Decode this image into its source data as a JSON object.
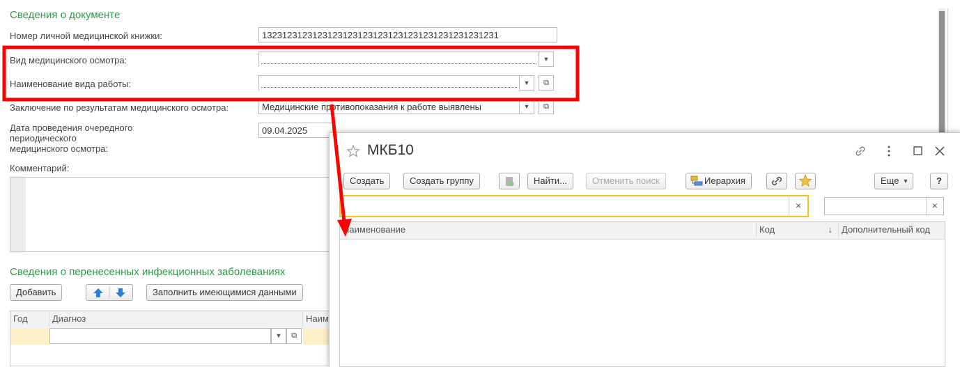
{
  "doc": {
    "section_title": "Сведения о документе",
    "med_book_label": "Номер личной медицинской книжки:",
    "med_book_value": "13231231231231231231231231231231231231231231231",
    "exam_type_label": "Вид медицинского осмотра:",
    "exam_type_value": "",
    "work_type_label": "Наименование вида работы:",
    "work_type_value": "",
    "conclusion_label": "Заключение по результатам медицинского осмотра:",
    "conclusion_value": "Медицинские противопоказания к работе выявлены",
    "date_label_1": "Дата проведения очередного",
    "date_label_2": "периодического",
    "date_label_3": "медицинского осмотра:",
    "date_value": "09.04.2025",
    "comment_label": "Комментарий:"
  },
  "diseases": {
    "section_title": "Сведения о перенесенных инфекционных заболеваниях",
    "add_button": "Добавить",
    "fill_button": "Заполнить имеющимися данными",
    "columns": [
      "Год",
      "Диагноз",
      "Наим"
    ]
  },
  "dialog": {
    "title": "МКБ10",
    "toolbar": {
      "create": "Создать",
      "create_group": "Создать группу",
      "find": "Найти...",
      "cancel_search": "Отменить поиск",
      "hierarchy": "Иерархия",
      "more": "Еще"
    },
    "search_value": "",
    "columns": [
      "Наименование",
      "Код",
      "Дополнительный код"
    ],
    "sort_indicator": "↓",
    "clear_glyph": "×",
    "help_glyph": "?"
  },
  "colors": {
    "section_green": "#2d9b47",
    "highlight_red": "#ff0000",
    "search_border": "#f0c419",
    "required_underline": "#e03030"
  },
  "icons": [
    "star-icon",
    "link-icon",
    "more-vert-icon",
    "maximize-icon",
    "close-icon",
    "arrow-up-icon",
    "arrow-down-icon",
    "hierarchy-icon",
    "link-chain-icon",
    "favorite-star-icon",
    "dropdown-icon",
    "open-icon"
  ]
}
